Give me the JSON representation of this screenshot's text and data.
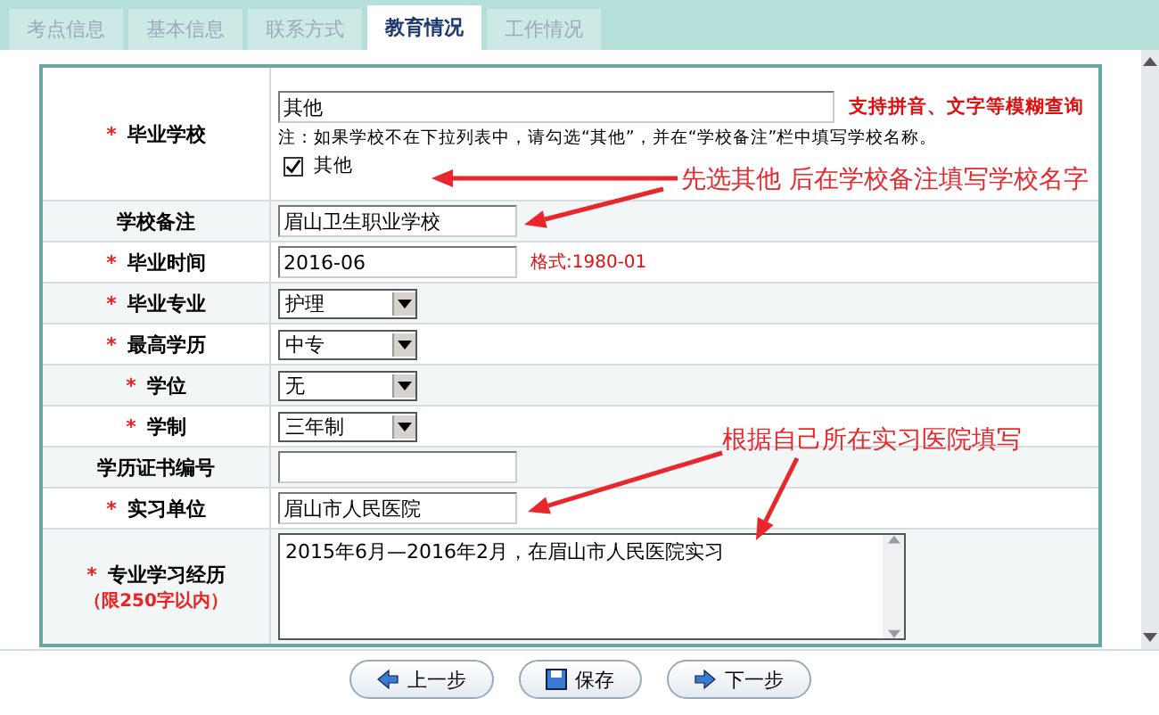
{
  "tabs": [
    {
      "label": "考点信息",
      "selected": false
    },
    {
      "label": "基本信息",
      "selected": false
    },
    {
      "label": "联系方式",
      "selected": false
    },
    {
      "label": "教育情况",
      "selected": true
    },
    {
      "label": "工作情况",
      "selected": false
    }
  ],
  "required_mark": "*",
  "rows": [
    {
      "kind": "school",
      "label": "毕业学校",
      "required": true,
      "value": "其他",
      "hint": "支持拼音、文字等模糊查询",
      "note": "注：如果学校不在下拉列表中，请勾选“其他”，并在“学校备注”栏中填写学校名称。",
      "checkbox": {
        "label": "其他",
        "checked": true
      }
    },
    {
      "kind": "text",
      "label": "学校备注",
      "required": false,
      "value": "眉山卫生职业学校"
    },
    {
      "kind": "text",
      "label": "毕业时间",
      "required": true,
      "value": "2016-06",
      "hint": "格式:1980-01"
    },
    {
      "kind": "select",
      "label": "毕业专业",
      "required": true,
      "value": "护理"
    },
    {
      "kind": "select",
      "label": "最高学历",
      "required": true,
      "value": "中专"
    },
    {
      "kind": "select",
      "label": "学位",
      "required": true,
      "value": "无"
    },
    {
      "kind": "select",
      "label": "学制",
      "required": true,
      "value": "三年制"
    },
    {
      "kind": "text",
      "label": "学历证书编号",
      "required": false
    },
    {
      "kind": "text",
      "label": "实习单位",
      "required": true,
      "value": "眉山市人民医院"
    },
    {
      "kind": "textarea",
      "label": "专业学习经历",
      "sublabel": "（限250字以内）",
      "required": true,
      "value": "2015年6月—2016年2月，在眉山市人民医院实习"
    }
  ],
  "annotations": [
    "先选其他 后在学校备注填写学校名字",
    "根据自己所在实习医院填写"
  ],
  "buttons": [
    {
      "label": "上一步",
      "kind": "prev"
    },
    {
      "label": "保存",
      "kind": "save"
    },
    {
      "label": "下一步",
      "kind": "next"
    }
  ]
}
